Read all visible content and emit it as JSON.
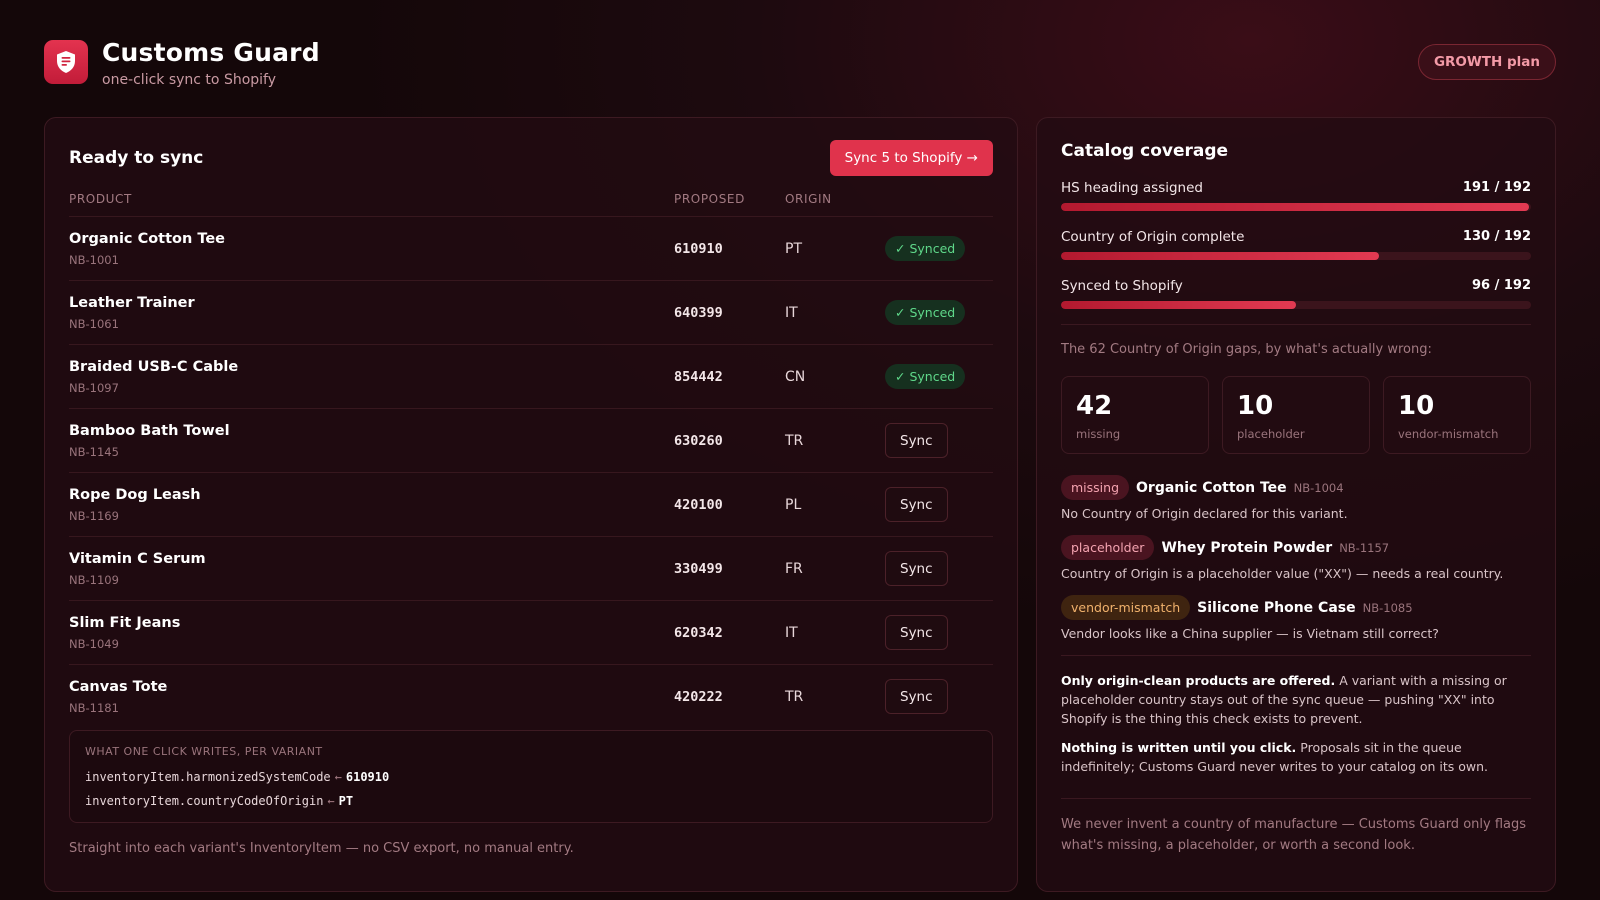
{
  "app": {
    "title": "Customs Guard",
    "subtitle": "one-click sync to Shopify",
    "plan": "GROWTH plan",
    "logo_icon": "shield-receipt-icon",
    "accent": "#e0334c"
  },
  "sync_panel": {
    "title": "Ready to sync",
    "sync_all_label": "Sync 5 to Shopify →",
    "columns": {
      "product": "PRODUCT",
      "proposed": "PROPOSED",
      "origin": "ORIGIN"
    },
    "rows": [
      {
        "name": "Organic Cotton Tee",
        "sku": "NB-1001",
        "code": "610910",
        "origin": "PT",
        "status": "synced",
        "status_label": "✓ Synced"
      },
      {
        "name": "Leather Trainer",
        "sku": "NB-1061",
        "code": "640399",
        "origin": "IT",
        "status": "synced",
        "status_label": "✓ Synced"
      },
      {
        "name": "Braided USB-C Cable",
        "sku": "NB-1097",
        "code": "854442",
        "origin": "CN",
        "status": "synced",
        "status_label": "✓ Synced"
      },
      {
        "name": "Bamboo Bath Towel",
        "sku": "NB-1145",
        "code": "630260",
        "origin": "TR",
        "status": "pending",
        "status_label": "Sync"
      },
      {
        "name": "Rope Dog Leash",
        "sku": "NB-1169",
        "code": "420100",
        "origin": "PL",
        "status": "pending",
        "status_label": "Sync"
      },
      {
        "name": "Vitamin C Serum",
        "sku": "NB-1109",
        "code": "330499",
        "origin": "FR",
        "status": "pending",
        "status_label": "Sync"
      },
      {
        "name": "Slim Fit Jeans",
        "sku": "NB-1049",
        "code": "620342",
        "origin": "IT",
        "status": "pending",
        "status_label": "Sync"
      },
      {
        "name": "Canvas Tote",
        "sku": "NB-1181",
        "code": "420222",
        "origin": "TR",
        "status": "pending",
        "status_label": "Sync"
      }
    ],
    "writes": {
      "title": "WHAT ONE CLICK WRITES, PER VARIANT",
      "arrow": "←",
      "lines": [
        {
          "field": "inventoryItem.harmonizedSystemCode",
          "value": "610910"
        },
        {
          "field": "inventoryItem.countryCodeOfOrigin",
          "value": "PT"
        }
      ]
    },
    "footnote": "Straight into each variant's InventoryItem — no CSV export, no manual entry."
  },
  "coverage_panel": {
    "title": "Catalog coverage",
    "metrics": [
      {
        "label": "HS heading assigned",
        "value_text": "191 / 192",
        "fraction": 0.995
      },
      {
        "label": "Country of Origin complete",
        "value_text": "130 / 192",
        "fraction": 0.677
      },
      {
        "label": "Synced to Shopify",
        "value_text": "96 / 192",
        "fraction": 0.5
      }
    ],
    "gaps_intro": "The 62 Country of Origin gaps, by what's actually wrong:",
    "stats": [
      {
        "num": "42",
        "label": "missing"
      },
      {
        "num": "10",
        "label": "placeholder"
      },
      {
        "num": "10",
        "label": "vendor-mismatch"
      }
    ],
    "issues": [
      {
        "tag": "missing",
        "kind": "missing",
        "name": "Organic Cotton Tee",
        "sku": "NB-1004",
        "desc": "No Country of Origin declared for this variant."
      },
      {
        "tag": "placeholder",
        "kind": "placeholder",
        "name": "Whey Protein Powder",
        "sku": "NB-1157",
        "desc": "Country of Origin is a placeholder value (\"XX\") — needs a real country."
      },
      {
        "tag": "vendor-mismatch",
        "kind": "vendor",
        "name": "Silicone Phone Case",
        "sku": "NB-1085",
        "desc": "Vendor looks like a China supplier — is Vietnam still correct?"
      }
    ],
    "notes": [
      {
        "bold": "Only origin-clean products are offered.",
        "text": " A variant with a missing or placeholder country stays out of the sync queue — pushing \"XX\" into Shopify is the thing this check exists to prevent."
      },
      {
        "bold": "Nothing is written until you click.",
        "text": " Proposals sit in the queue indefinitely; Customs Guard never writes to your catalog on its own."
      }
    ],
    "footer": "We never invent a country of manufacture — Customs Guard only flags what's missing, a placeholder, or worth a second look."
  }
}
